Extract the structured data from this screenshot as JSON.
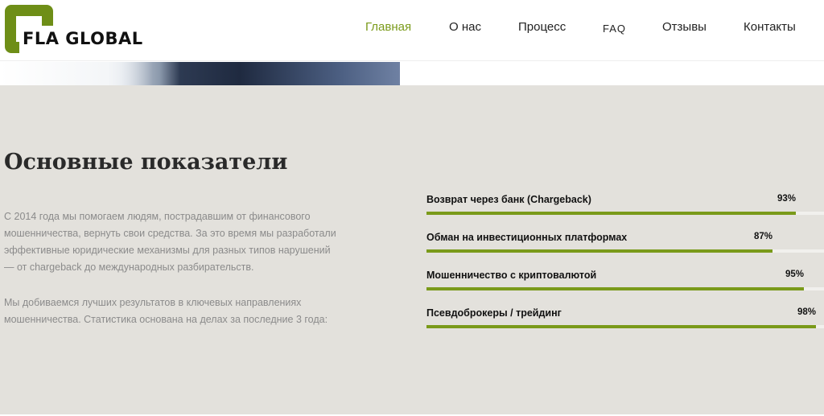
{
  "brand": {
    "logo_text": "FLA GLOBAL",
    "accent_color": "#7a9a1a"
  },
  "nav": {
    "items": [
      {
        "label": "Главная",
        "active": true
      },
      {
        "label": "О нас"
      },
      {
        "label": "Процесс"
      },
      {
        "label": "FAQ"
      },
      {
        "label": "Отзывы"
      },
      {
        "label": "Контакты"
      }
    ]
  },
  "stats": {
    "title": "Основные показатели",
    "paragraph1": "С 2014 года мы помогаем людям, пострадавшим от финансового мошенничества, вернуть свои средства. За это время мы разработали эффективные юридические механизмы для разных типов нарушений — от chargeback до международных разбирательств.",
    "paragraph2": "Мы добиваемся лучших результатов в ключевых направлениях мошенничества. Статистика основана на делах за последние 3 года:",
    "bars": [
      {
        "label": "Возврат через банк (Chargeback)",
        "percent": 93,
        "percent_text": "93%"
      },
      {
        "label": "Обман на инвестиционных платформах",
        "percent": 87,
        "percent_text": "87%"
      },
      {
        "label": "Мошенничество с криптовалютой",
        "percent": 95,
        "percent_text": "95%"
      },
      {
        "label": "Псевдоброкеры / трейдинг",
        "percent": 98,
        "percent_text": "98%"
      }
    ]
  }
}
